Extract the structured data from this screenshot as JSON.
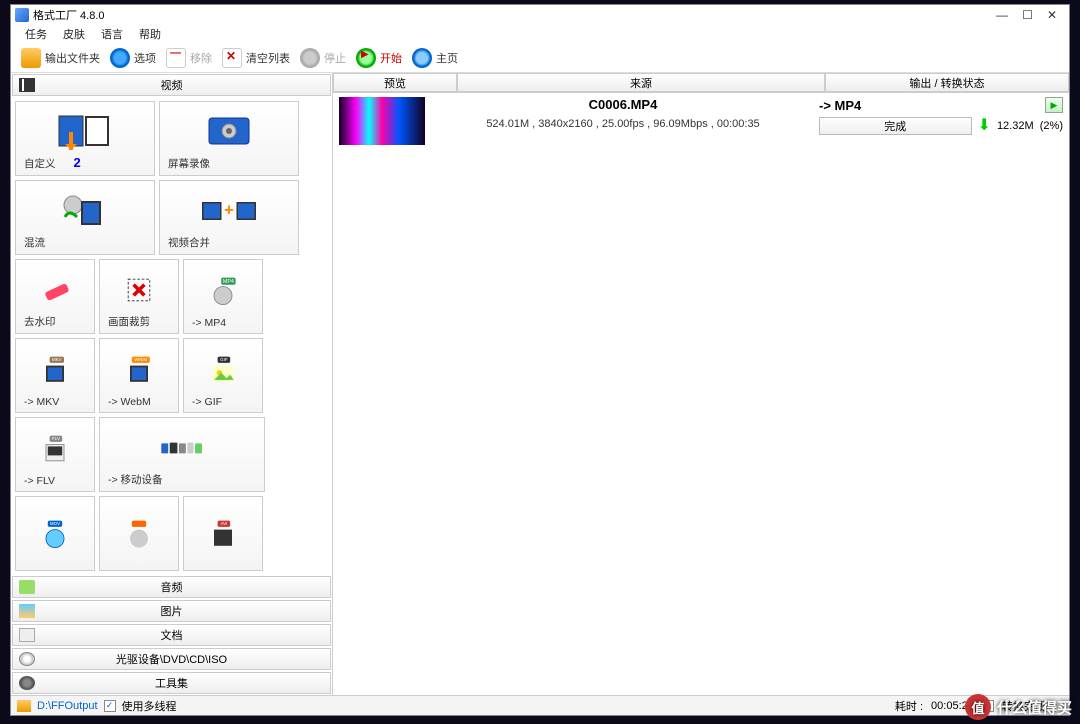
{
  "window": {
    "title": "格式工厂 4.8.0"
  },
  "menubar": [
    "任务",
    "皮肤",
    "语言",
    "帮助"
  ],
  "toolbar": {
    "output_folder": "输出文件夹",
    "options": "选项",
    "remove": "移除",
    "clear_list": "清空列表",
    "stop": "停止",
    "start": "开始",
    "home": "主页"
  },
  "categories": {
    "video": "视频",
    "audio": "音频",
    "picture": "图片",
    "document": "文档",
    "disc": "光驱设备\\DVD\\CD\\ISO",
    "toolset": "工具集"
  },
  "tiles": {
    "custom": "自定义",
    "custom_badge": "2",
    "screen_record": "屏幕录像",
    "mix": "混流",
    "video_merge": "视频合并",
    "remove_watermark": "去水印",
    "crop": "画面裁剪",
    "to_mp4": "-> MP4",
    "to_mkv": "-> MKV",
    "to_webm": "-> WebM",
    "to_gif": "-> GIF",
    "to_flv": "-> FLV",
    "to_mobile": "-> 移动设备"
  },
  "columns": {
    "preview": "预览",
    "source": "来源",
    "output_status": "输出 / 转换状态"
  },
  "task": {
    "filename": "C0006.MP4",
    "info": "524.01M , 3840x2160 , 25.00fps , 96.09Mbps , 00:00:35",
    "out_format": "-> MP4",
    "done": "完成",
    "size": "12.32M",
    "percent": "(2%)"
  },
  "statusbar": {
    "path": "D:\\FFOutput",
    "multithread": "使用多线程",
    "elapsed_label": "耗时 :",
    "elapsed": "00:05:23",
    "after_label": "转换完成后 :"
  },
  "watermark": "什么值得买"
}
